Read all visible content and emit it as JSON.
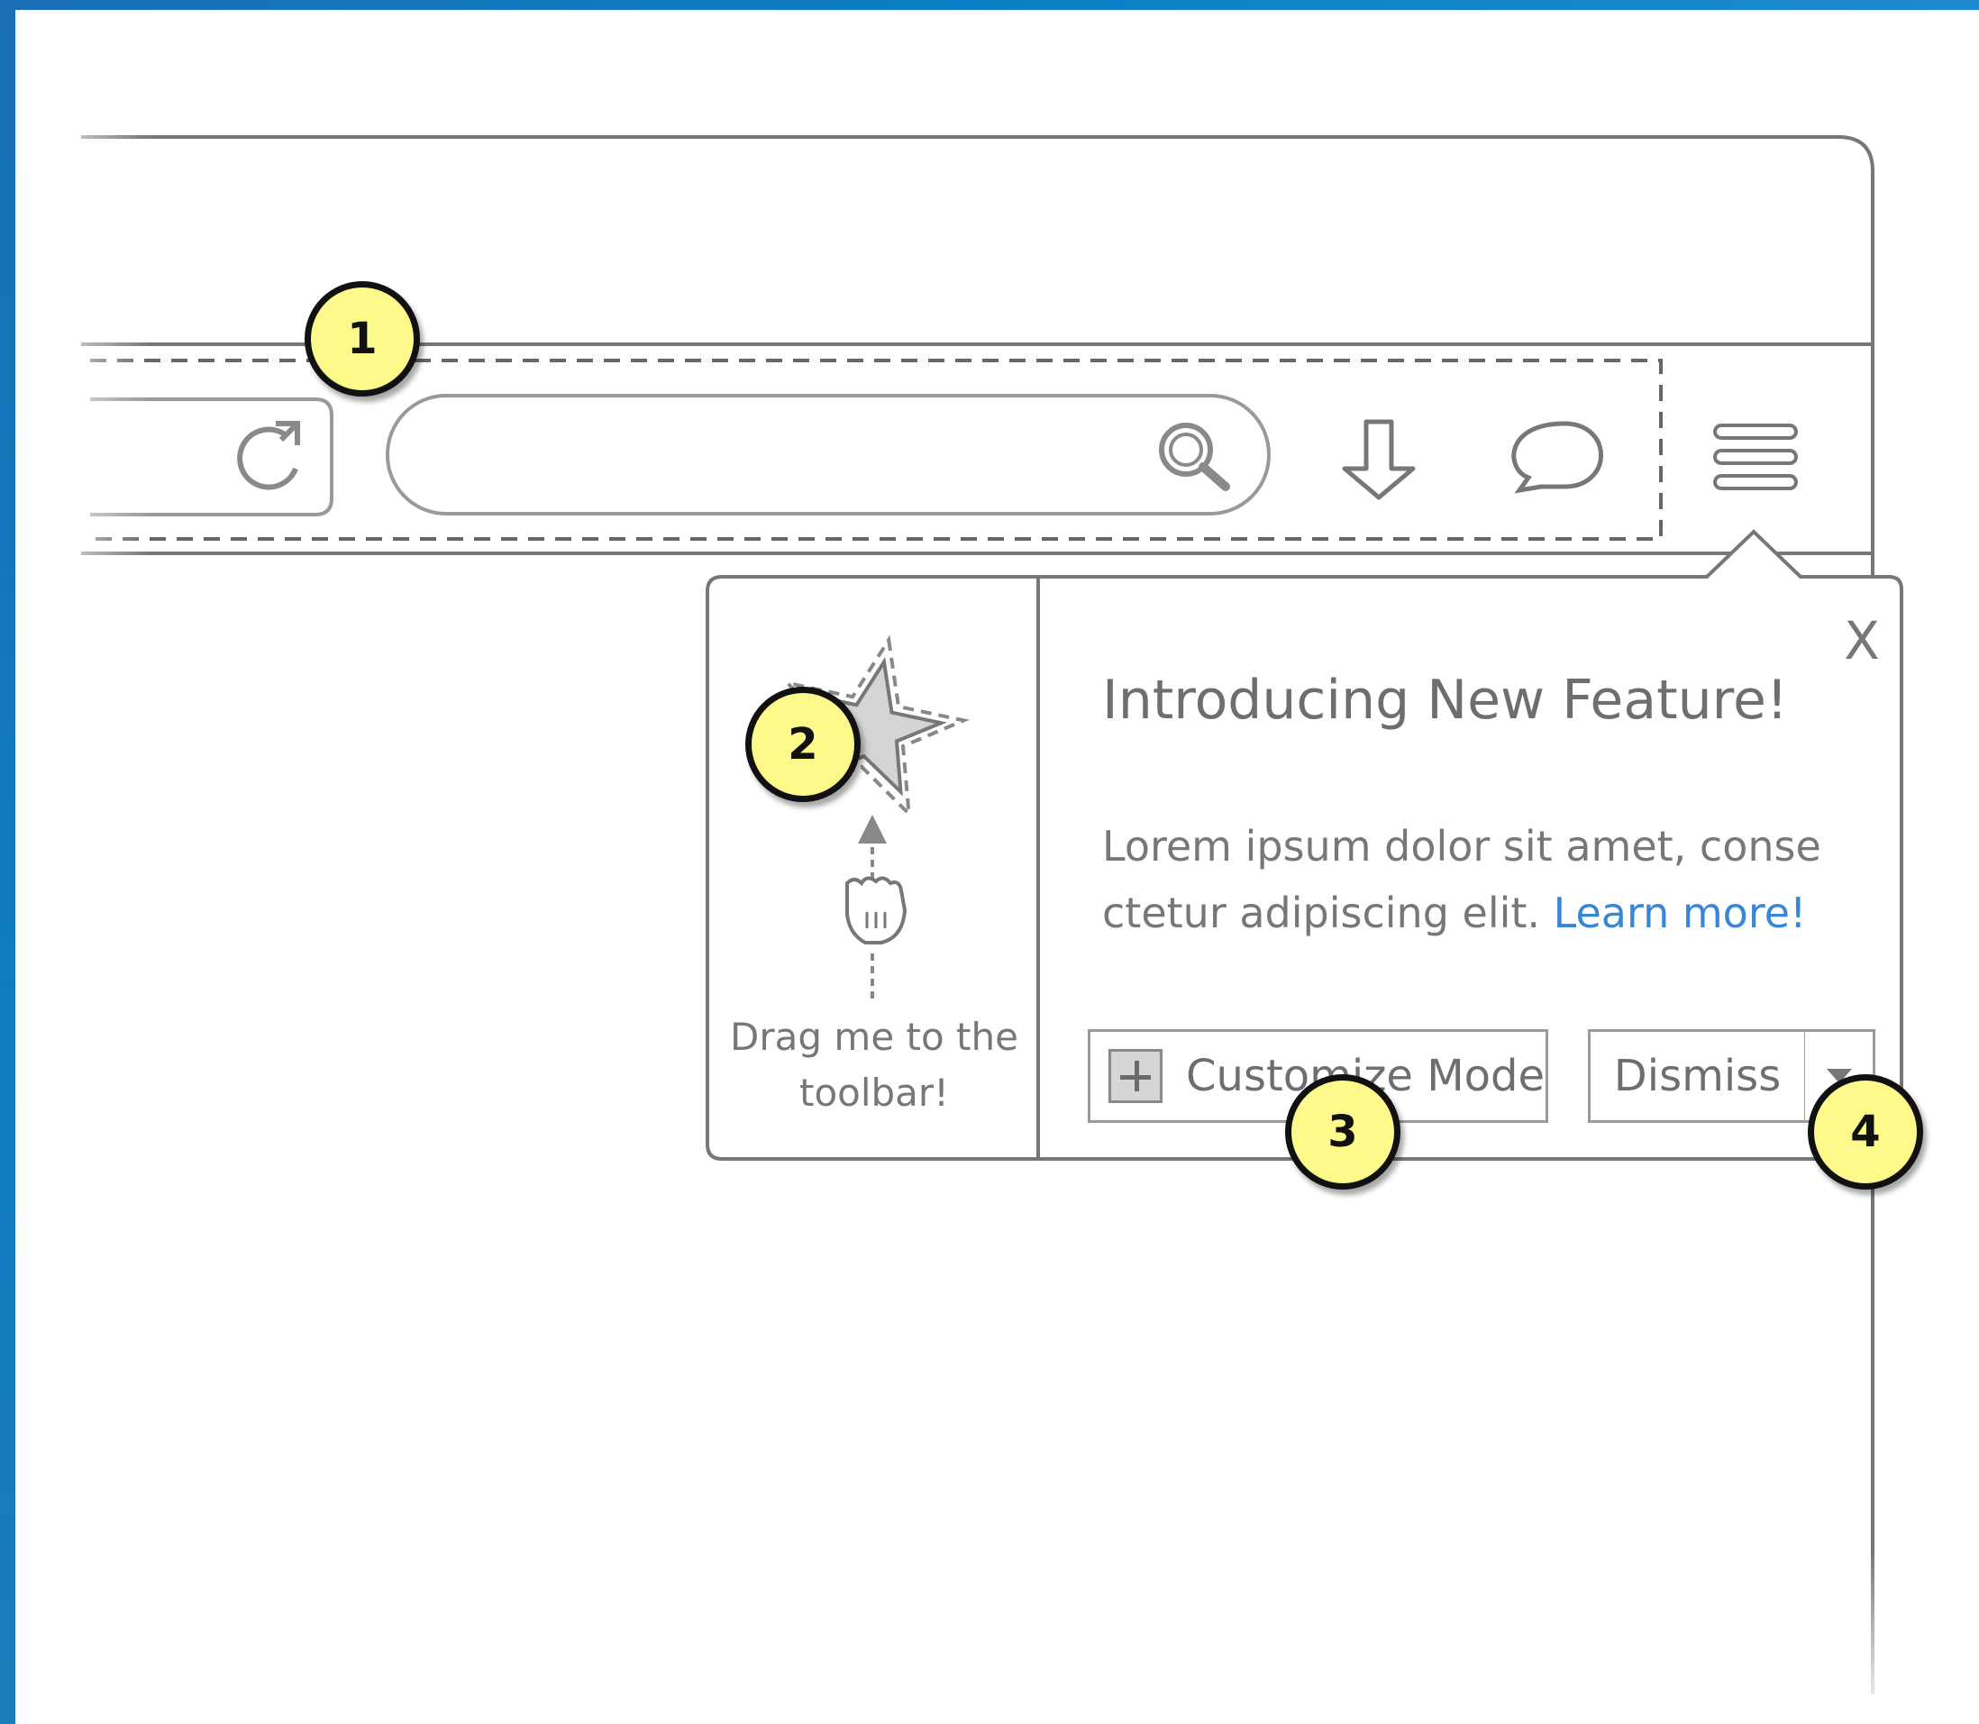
{
  "popup": {
    "title": "Introducing New Feature!",
    "body": "Lorem ipsum dolor sit amet, conse ctetur adipiscing elit.",
    "learn_more": "Learn more!",
    "close_label": "X",
    "drag_hint": "Drag me to the toolbar!",
    "customize_button": "Customize Mode",
    "dismiss_button": "Dismiss"
  },
  "callouts": [
    "1",
    "2",
    "3",
    "4"
  ],
  "toolbar": {
    "icons": [
      "reload-icon",
      "search-icon",
      "download-icon",
      "chat-icon",
      "menu-icon"
    ]
  },
  "colors": {
    "frame_blue": "#0a7fc6",
    "callout_fill": "#fdf98a",
    "link_blue": "#3a86d6",
    "wire_gray": "#777777"
  }
}
